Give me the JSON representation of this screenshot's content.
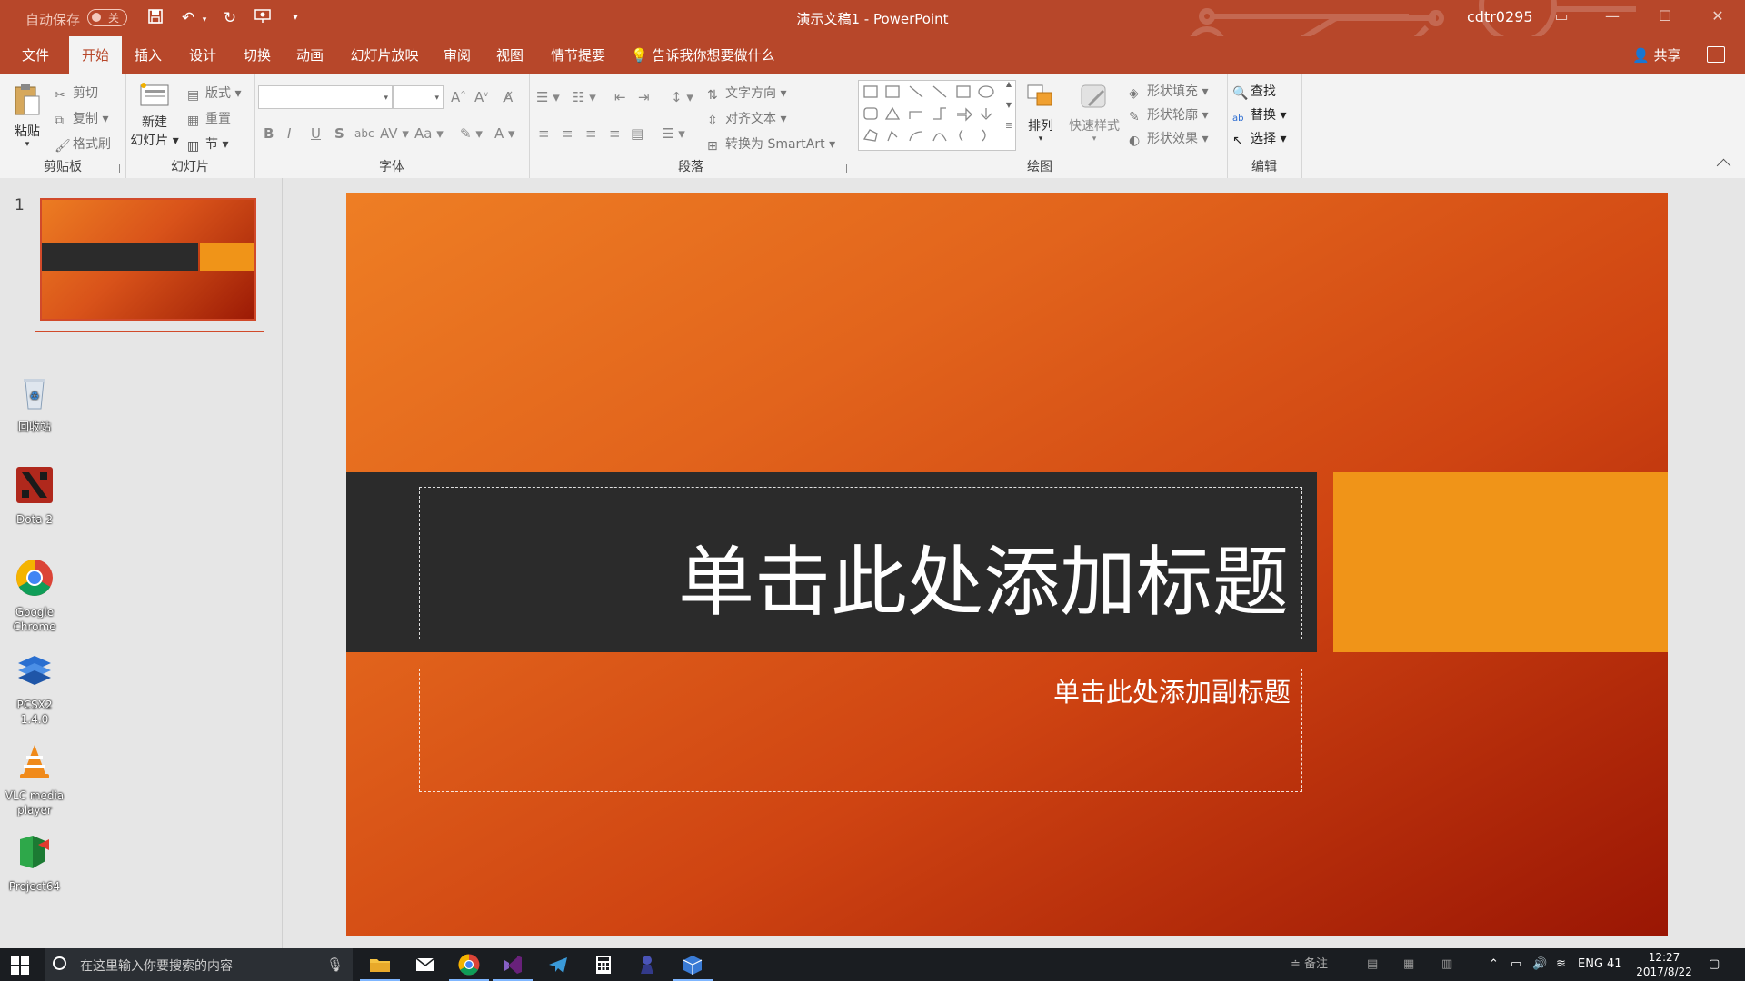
{
  "titlebar": {
    "autosave_label": "自动保存",
    "autosave_state": "关",
    "doc_title": "演示文稿1  -  PowerPoint",
    "user": "cdtr0295",
    "accent_color": "#b7472a"
  },
  "tabs": [
    {
      "label": "文件"
    },
    {
      "label": "开始"
    },
    {
      "label": "插入"
    },
    {
      "label": "设计"
    },
    {
      "label": "切换"
    },
    {
      "label": "动画"
    },
    {
      "label": "幻灯片放映"
    },
    {
      "label": "审阅"
    },
    {
      "label": "视图"
    },
    {
      "label": "情节提要"
    }
  ],
  "tell_me": "告诉我你想要做什么",
  "share_label": "共享",
  "ribbon": {
    "clipboard": {
      "paste": "粘贴",
      "cut": "剪切",
      "copy": "复制",
      "format_painter": "格式刷",
      "label": "剪贴板"
    },
    "slides": {
      "new_slide_line1": "新建",
      "new_slide_line2": "幻灯片",
      "layout": "版式",
      "reset": "重置",
      "section": "节",
      "label": "幻灯片"
    },
    "font": {
      "label": "字体",
      "bold": "B",
      "italic": "I",
      "underline": "U",
      "shadow": "S",
      "strike": "abc",
      "spacing": "AV",
      "case": "Aa",
      "color": "A"
    },
    "paragraph": {
      "label": "段落",
      "text_direction": "文字方向",
      "align_text": "对齐文本",
      "smartart": "转换为 SmartArt"
    },
    "drawing": {
      "label": "绘图",
      "arrange": "排列",
      "quick_styles": "快速样式",
      "shape_fill": "形状填充",
      "shape_outline": "形状轮廓",
      "shape_effects": "形状效果"
    },
    "editing": {
      "label": "编辑",
      "find": "查找",
      "replace": "替换",
      "select": "选择"
    }
  },
  "thumbnail": {
    "number": "1"
  },
  "desktop_icons": [
    {
      "label": "回收站",
      "icon": "recycle-bin-icon"
    },
    {
      "label": "Dota 2",
      "icon": "dota-icon"
    },
    {
      "label": "Google Chrome",
      "icon": "chrome-icon"
    },
    {
      "label": "PCSX2 1.4.0",
      "icon": "pcsx2-icon"
    },
    {
      "label": "VLC media player",
      "icon": "vlc-icon"
    },
    {
      "label": "Project64",
      "icon": "project64-icon"
    }
  ],
  "slide": {
    "title_placeholder": "单击此处添加标题",
    "subtitle_placeholder": "单击此处添加副标题",
    "colors": {
      "band": "#2b2b2b",
      "accent": "#f09418",
      "gradient_start": "#ee7e24",
      "gradient_end": "#9a1604"
    }
  },
  "taskbar": {
    "search_placeholder": "在这里输入你要搜索的内容",
    "notes_label": "备注",
    "lang": "ENG",
    "badge": "41",
    "time": "12:27",
    "date": "2017/8/22"
  }
}
